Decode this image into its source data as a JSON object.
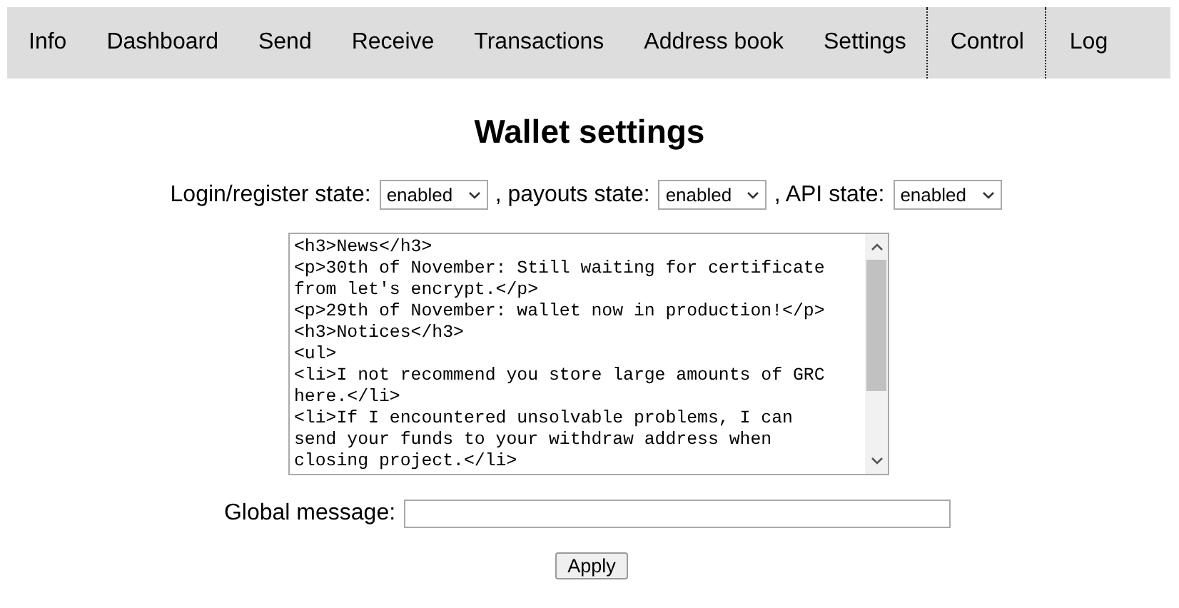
{
  "nav": {
    "items": [
      {
        "label": "Info",
        "kind": "main"
      },
      {
        "label": "Dashboard",
        "kind": "main"
      },
      {
        "label": "Send",
        "kind": "main"
      },
      {
        "label": "Receive",
        "kind": "main"
      },
      {
        "label": "Transactions",
        "kind": "main"
      },
      {
        "label": "Address book",
        "kind": "main"
      },
      {
        "label": "Settings",
        "kind": "main"
      },
      {
        "label": "Control",
        "kind": "admin"
      },
      {
        "label": "Log",
        "kind": "admin"
      }
    ]
  },
  "title": "Wallet settings",
  "states": [
    {
      "label": "Login/register state:",
      "value": "enabled"
    },
    {
      "label": ", payouts state:",
      "value": "enabled"
    },
    {
      "label": ", API state:",
      "value": "enabled"
    }
  ],
  "editor": {
    "lines": [
      "<h3>News</h3>",
      "<p>30th of November: Still waiting for certificate",
      "from let's encrypt.</p>",
      "<p>29th of November: wallet now in production!</p>",
      "<h3>Notices</h3>",
      "<ul>",
      "<li>I not recommend you store large amounts of GRC",
      "here.</li>",
      "<li>If I encountered unsolvable problems, I can",
      "send your funds to your withdraw address when",
      "closing project.</li>"
    ]
  },
  "global_message": {
    "label": "Global message:"
  },
  "apply_button": "Apply"
}
